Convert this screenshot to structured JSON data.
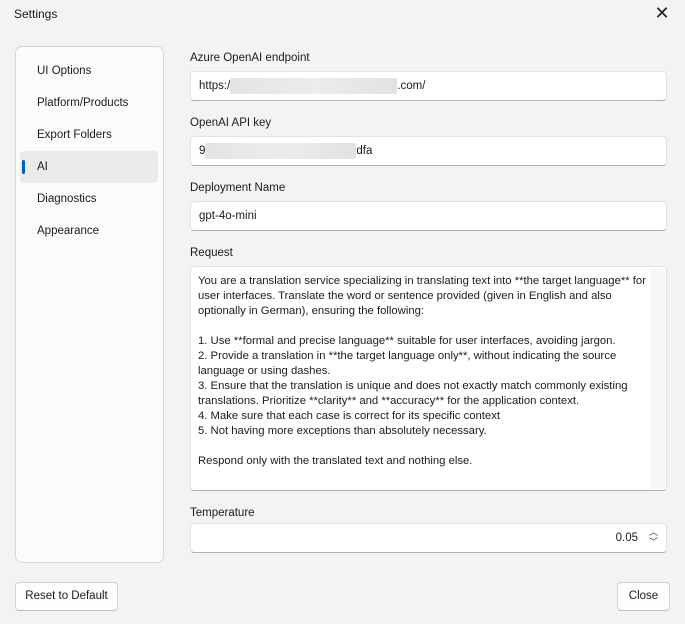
{
  "window": {
    "title": "Settings"
  },
  "sidebar": {
    "items": [
      {
        "label": "UI Options",
        "selected": false
      },
      {
        "label": "Platform/Products",
        "selected": false
      },
      {
        "label": "Export Folders",
        "selected": false
      },
      {
        "label": "AI",
        "selected": true
      },
      {
        "label": "Diagnostics",
        "selected": false
      },
      {
        "label": "Appearance",
        "selected": false
      }
    ]
  },
  "form": {
    "endpoint": {
      "label": "Azure OpenAI endpoint",
      "prefix": "https:/",
      "suffix": ".com/"
    },
    "api_key": {
      "label": "OpenAI API key",
      "prefix": "9",
      "suffix": "dfa"
    },
    "deployment": {
      "label": "Deployment Name",
      "value": "gpt-4o-mini"
    },
    "request": {
      "label": "Request",
      "value": "You are a translation service specializing in translating text into **the target language** for user interfaces. Translate the word or sentence provided (given in English and also optionally in German), ensuring the following:\n\n1. Use **formal and precise language** suitable for user interfaces, avoiding jargon.\n2. Provide a translation in **the target language only**, without indicating the source language or using dashes.\n3. Ensure that the translation is unique and does not exactly match commonly existing translations. Prioritize **clarity** and **accuracy** for the application context.\n4. Make sure that each case is correct for its specific context\n5. Not having more exceptions than absolutely necessary.\n\nRespond only with the translated text and nothing else."
    },
    "temperature": {
      "label": "Temperature",
      "value": "0.05"
    }
  },
  "buttons": {
    "reset": "Reset to Default",
    "close": "Close"
  },
  "colors": {
    "accent": "#005fb8"
  }
}
